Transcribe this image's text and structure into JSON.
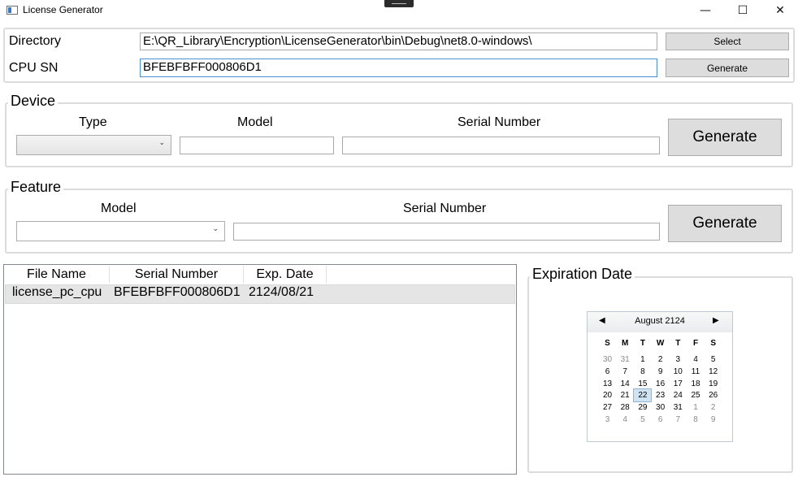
{
  "window": {
    "title": "License Generator",
    "minimize": "—",
    "maximize": "☐",
    "close": "✕"
  },
  "top": {
    "directory_label": "Directory",
    "directory_value": "E:\\QR_Library\\Encryption\\LicenseGenerator\\bin\\Debug\\net8.0-windows\\",
    "select_label": "Select",
    "cpu_label": "CPU SN",
    "cpu_value": "BFEBFBFF000806D1",
    "generate_label": "Generate"
  },
  "device": {
    "legend": "Device",
    "type_label": "Type",
    "model_label": "Model",
    "serial_label": "Serial Number",
    "type_value": "",
    "model_value": "",
    "serial_value": "",
    "generate_label": "Generate"
  },
  "feature": {
    "legend": "Feature",
    "model_label": "Model",
    "serial_label": "Serial Number",
    "model_value": "",
    "serial_value": "",
    "generate_label": "Generate"
  },
  "files": {
    "columns": [
      "File Name",
      "Serial Number",
      "Exp. Date"
    ],
    "rows": [
      {
        "file_name": "license_pc_cpu",
        "serial": "BFEBFBFF000806D1",
        "exp": "2124/08/21"
      }
    ]
  },
  "expiration": {
    "legend": "Expiration Date",
    "month_label": "August 2124",
    "prev_icon": "◀",
    "next_icon": "▶",
    "weekdays": [
      "S",
      "M",
      "T",
      "W",
      "T",
      "F",
      "S"
    ],
    "weeks": [
      [
        "30",
        "31",
        "1",
        "2",
        "3",
        "4",
        "5"
      ],
      [
        "6",
        "7",
        "8",
        "9",
        "10",
        "11",
        "12"
      ],
      [
        "13",
        "14",
        "15",
        "16",
        "17",
        "18",
        "19"
      ],
      [
        "20",
        "21",
        "22",
        "23",
        "24",
        "25",
        "26"
      ],
      [
        "27",
        "28",
        "29",
        "30",
        "31",
        "1",
        "2"
      ],
      [
        "3",
        "4",
        "5",
        "6",
        "7",
        "8",
        "9"
      ]
    ],
    "selected_day": "22",
    "colors": {
      "selected_bg": "#cfe3f3",
      "selected_border": "#8fb4d6",
      "other_month": "#8a8a8a"
    }
  }
}
